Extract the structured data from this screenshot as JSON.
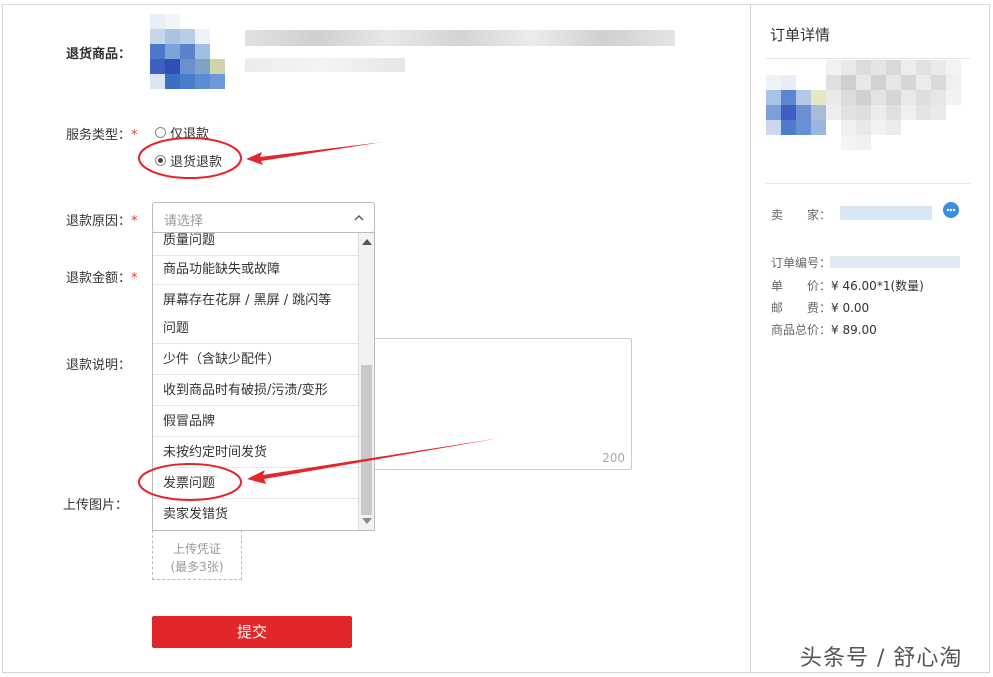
{
  "form": {
    "product_label": "退货商品：",
    "service_type_label": "服务类型：",
    "required_mark": "*",
    "service_options": [
      "仅退款",
      "退货退款"
    ],
    "service_selected": "退货退款",
    "reason_label": "退款原因：",
    "reason_placeholder": "请选择",
    "amount_label": "退款金额：",
    "note_label": "退款说明：",
    "note_counter": "200",
    "upload_label": "上传图片：",
    "upload_button": [
      "上传凭证",
      "(最多3张)"
    ],
    "submit_label": "提交"
  },
  "reason_options": [
    "质量问题",
    "商品功能缺失或故障",
    "屏幕存在花屏 / 黑屏 / 跳闪等",
    "问题",
    "少件（含缺少配件）",
    "收到商品时有破损/污渍/变形",
    "假冒品牌",
    "未按约定时间发货",
    "发票问题",
    "卖家发错货"
  ],
  "order": {
    "title": "订单详情",
    "seller_label": "卖　　家：",
    "order_no_label": "订单编号：",
    "unit_price_label": "单　　价：",
    "unit_price_value": "¥ 46.00*1(数量)",
    "shipping_label": "邮　　费：",
    "shipping_value": "¥ 0.00",
    "total_label": "商品总价：",
    "total_value": "¥ 89.00"
  },
  "colors": {
    "accent_red": "#e3262a",
    "annotation_red": "#e3262a",
    "border": "#d6d6d6"
  },
  "icons": {
    "chevron": "chevron-up-icon",
    "chat": "chat-bubble-icon"
  },
  "watermark": "头条号 / 舒心淘"
}
